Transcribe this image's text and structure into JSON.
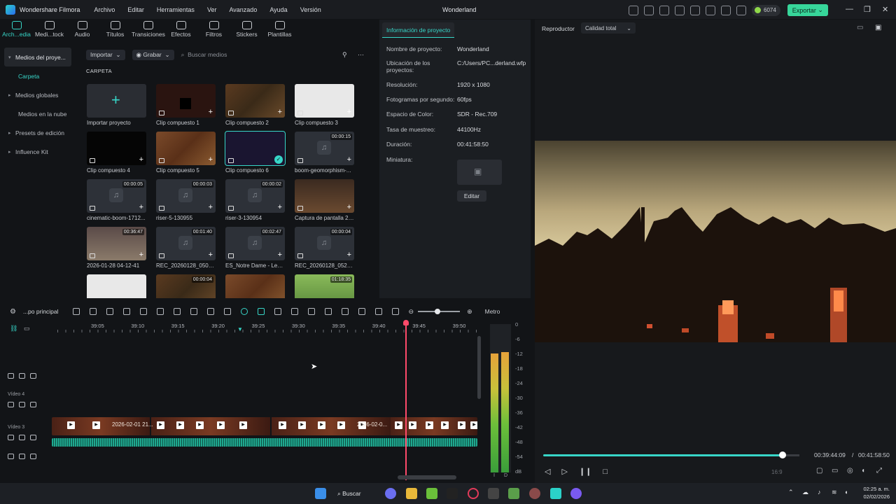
{
  "app": {
    "name": "Wondershare Filmora",
    "doc_title": "Wonderland",
    "credits": "6074",
    "export": "Exportar"
  },
  "menu": [
    "Archivo",
    "Editar",
    "Herramientas",
    "Ver",
    "Avanzado",
    "Ayuda",
    "Versión"
  ],
  "toolbar": [
    "Arch...edia",
    "Medi...tock",
    "Audio",
    "Títulos",
    "Transiciones",
    "Efectos",
    "Filtros",
    "Stickers",
    "Plantillas"
  ],
  "sidebar": {
    "project": "Medios del proye...",
    "folder": "Carpeta",
    "global": "Medios globales",
    "cloud": "Medios en la nube",
    "presets": "Presets de edición",
    "influence": "Influence Kit"
  },
  "media": {
    "import": "Importar",
    "record": "Grabar",
    "search_placeholder": "Buscar medios",
    "folder_label": "CARPETA"
  },
  "cards": [
    {
      "name": "Importar proyecto",
      "dur": "",
      "kind": "import"
    },
    {
      "name": "Clip compuesto 1",
      "dur": "",
      "kind": "dark"
    },
    {
      "name": "Clip compuesto 2",
      "dur": "",
      "kind": "mine"
    },
    {
      "name": "Clip compuesto 3",
      "dur": "",
      "kind": "doc"
    },
    {
      "name": "Clip compuesto 4",
      "dur": "",
      "kind": "black"
    },
    {
      "name": "Clip compuesto 5",
      "dur": "",
      "kind": "brick"
    },
    {
      "name": "Clip compuesto 6",
      "dur": "",
      "kind": "selected"
    },
    {
      "name": "boom-geomorphism-...",
      "dur": "00:00:15",
      "kind": "audio"
    },
    {
      "name": "cinematic-boom-1712...",
      "dur": "00:00:05",
      "kind": "audio"
    },
    {
      "name": "riser-5-130955",
      "dur": "00:00:03",
      "kind": "audio"
    },
    {
      "name": "riser-3-130954",
      "dur": "00:00:02",
      "kind": "audio"
    },
    {
      "name": "Captura de pantalla 20...",
      "dur": "",
      "kind": "shot"
    },
    {
      "name": "2026-01-28 04-12-41",
      "dur": "00:36:47",
      "kind": "video"
    },
    {
      "name": "REC_20260128_050657",
      "dur": "00:01:40",
      "kind": "audio"
    },
    {
      "name": "ES_Notre Dame - Lenn...",
      "dur": "00:02:47",
      "kind": "audio"
    },
    {
      "name": "REC_20260128_052727",
      "dur": "00:00:04",
      "kind": "audio"
    },
    {
      "name": "",
      "dur": "",
      "kind": "doc"
    },
    {
      "name": "",
      "dur": "00:00:04",
      "kind": "mine"
    },
    {
      "name": "",
      "dur": "",
      "kind": "brick"
    },
    {
      "name": "",
      "dur": "01:18:35",
      "kind": "green"
    }
  ],
  "info": {
    "tab": "Información de proyecto",
    "rows": [
      {
        "k": "Nombre de proyecto:",
        "v": "Wonderland"
      },
      {
        "k": "Ubicación de los proyectos:",
        "v": "C:/Users/PC...derland.wfp"
      },
      {
        "k": "Resolución:",
        "v": "1920 x 1080"
      },
      {
        "k": "Fotogramas por segundo:",
        "v": "60fps"
      },
      {
        "k": "Espacio de Color:",
        "v": "SDR - Rec.709"
      },
      {
        "k": "Tasa de muestreo:",
        "v": "44100Hz"
      },
      {
        "k": "Duración:",
        "v": "00:41:58:50"
      },
      {
        "k": "Miniatura:",
        "v": ""
      }
    ],
    "edit": "Editar"
  },
  "player": {
    "label": "Reproductor",
    "quality": "Calidad total",
    "current": "00:39:44:09",
    "sep": "/",
    "total": "00:41:58:50",
    "progress": 0.935,
    "ratio": "16:9"
  },
  "timeline": {
    "sequence": "...po principal",
    "meter": "Metro",
    "ticks": [
      "39:05",
      "39:10",
      "39:15",
      "39:20",
      "39:25",
      "39:30",
      "39:35",
      "39:40",
      "39:45",
      "39:50"
    ],
    "tracks": {
      "v4": "Vídeo 4",
      "v3": "Vídeo 3"
    },
    "clip_labels": [
      "2026-02-01 21...",
      "2026-02-0..."
    ],
    "meter_scale": [
      "0",
      "-6",
      "-12",
      "-18",
      "-24",
      "-30",
      "-36",
      "-42",
      "-48",
      "-54",
      "dB"
    ],
    "meter_lr": [
      "I",
      "D"
    ]
  },
  "taskbar": {
    "search": "Buscar",
    "time": "02:25 a. m.",
    "date": "02/02/2026"
  }
}
